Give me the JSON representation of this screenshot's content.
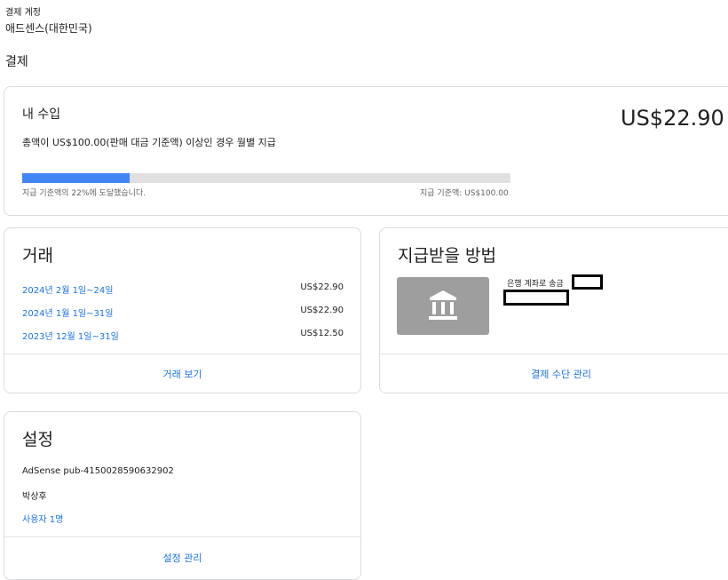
{
  "breadcrumb": {
    "label": "결제 계정",
    "account": "애드센스(대한민국)"
  },
  "page": {
    "title": "결제"
  },
  "earnings": {
    "title": "내 수입",
    "amount": "US$22.90",
    "description": "총액이 US$100.00(판매 대금 기준액) 이상인 경우 월별 지급",
    "progress_fraction": 0.22,
    "progress_text": "지급 기준액의 22%에 도달했습니다.",
    "threshold_text": "지급 기준액: US$100.00"
  },
  "transactions": {
    "title": "거래",
    "rows": [
      {
        "period": "2024년 2월 1일~24일",
        "amount": "US$22.90"
      },
      {
        "period": "2024년 1월 1일~31일",
        "amount": "US$22.90"
      },
      {
        "period": "2023년 12월 1일~31일",
        "amount": "US$12.50"
      }
    ],
    "view_link": "거래 보기"
  },
  "payment_method": {
    "title": "지급받을 방법",
    "icon": "bank-icon",
    "method_label": "은행 계좌로 송금",
    "manage_link": "결제 수단 관리"
  },
  "settings": {
    "title": "설정",
    "publisher_id": "AdSense pub-4150028590632902",
    "name": "박상후",
    "users_link": "사용자 1명",
    "manage_link": "설정 관리"
  },
  "colors": {
    "accent": "#1a73e8",
    "progress": "#4285f4",
    "icon_bg": "#9e9e9e"
  }
}
